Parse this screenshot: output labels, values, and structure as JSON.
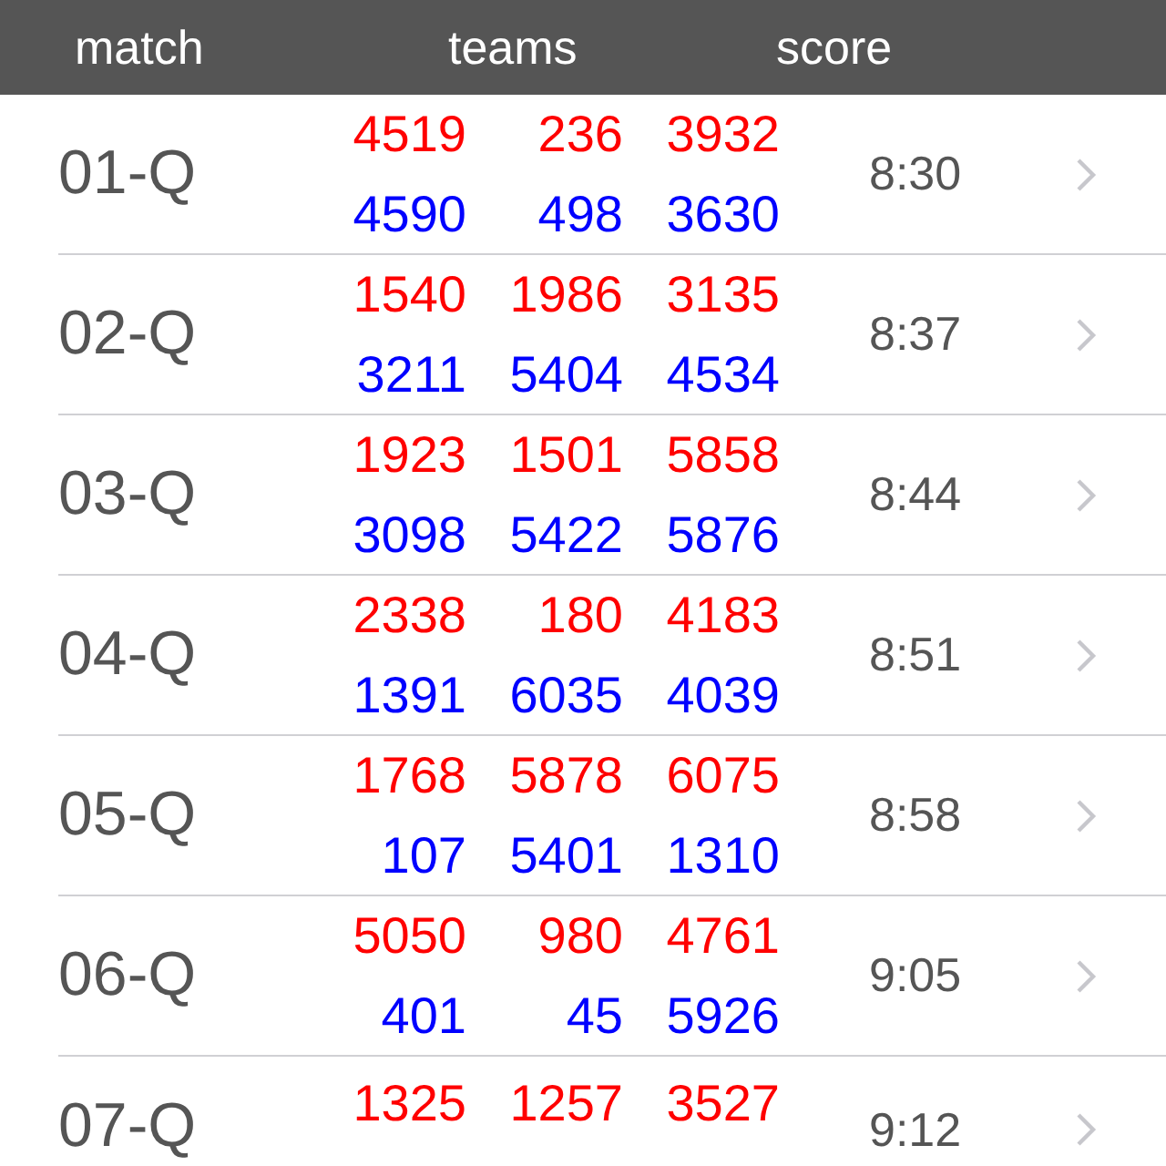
{
  "header": {
    "columns": [
      "match",
      "teams",
      "score"
    ]
  },
  "matches": [
    {
      "match": "01-Q",
      "red": [
        "4519",
        "236",
        "3932"
      ],
      "blue": [
        "4590",
        "498",
        "3630"
      ],
      "time": "8:30"
    },
    {
      "match": "02-Q",
      "red": [
        "1540",
        "1986",
        "3135"
      ],
      "blue": [
        "3211",
        "5404",
        "4534"
      ],
      "time": "8:37"
    },
    {
      "match": "03-Q",
      "red": [
        "1923",
        "1501",
        "5858"
      ],
      "blue": [
        "3098",
        "5422",
        "5876"
      ],
      "time": "8:44"
    },
    {
      "match": "04-Q",
      "red": [
        "2338",
        "180",
        "4183"
      ],
      "blue": [
        "1391",
        "6035",
        "4039"
      ],
      "time": "8:51"
    },
    {
      "match": "05-Q",
      "red": [
        "1768",
        "5878",
        "6075"
      ],
      "blue": [
        "107",
        "5401",
        "1310"
      ],
      "time": "8:58"
    },
    {
      "match": "06-Q",
      "red": [
        "5050",
        "980",
        "4761"
      ],
      "blue": [
        "401",
        "45",
        "5926"
      ],
      "time": "9:05"
    },
    {
      "match": "07-Q",
      "red": [
        "1325",
        "1257",
        "3527"
      ],
      "time": "9:12"
    }
  ]
}
